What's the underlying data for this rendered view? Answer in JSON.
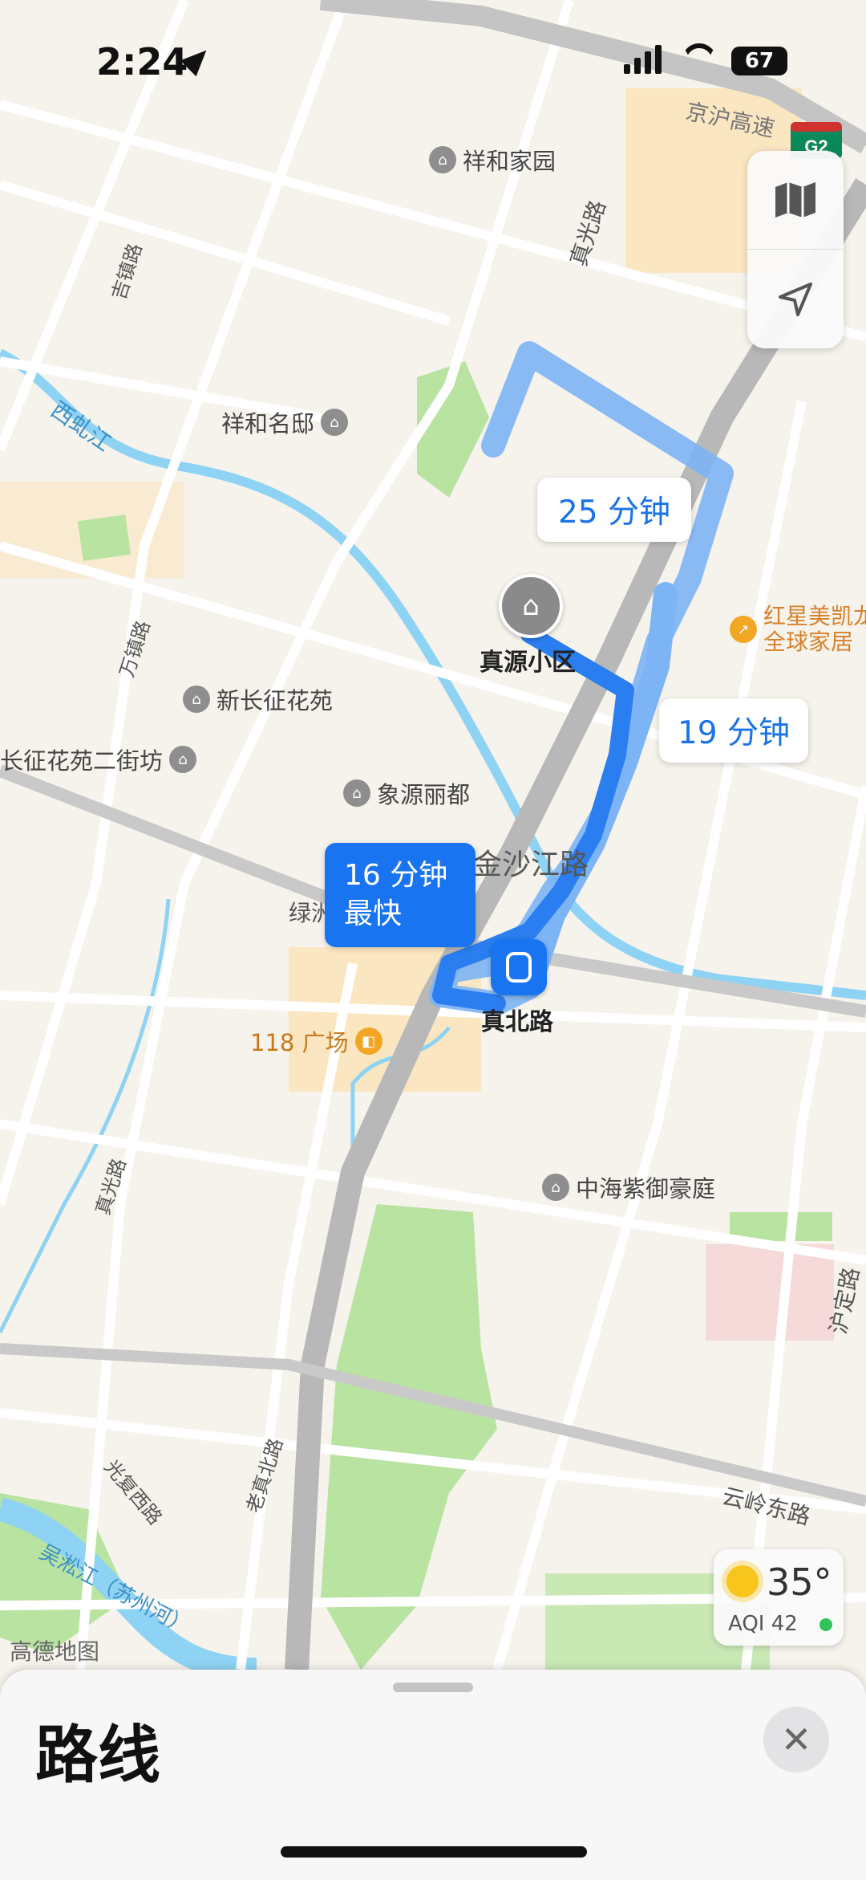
{
  "status_bar": {
    "time": "2:24",
    "battery": "67"
  },
  "map": {
    "labels": [
      {
        "name": "road-label-jinghu-highway",
        "text": "京沪高速"
      },
      {
        "name": "road-label-zhenguang-road-north",
        "text": "真光路"
      },
      {
        "name": "road-label-jizhen-road",
        "text": "吉镇路"
      },
      {
        "name": "river-label-xiyan-river",
        "text": "西虬江"
      },
      {
        "name": "road-label-wanzhen-road",
        "text": "万镇路"
      },
      {
        "name": "road-label-jinshajiang-road",
        "text": "金沙江路"
      },
      {
        "name": "road-label-lvzhou",
        "text": "绿洲"
      },
      {
        "name": "road-label-zhenguang-road-south",
        "text": "真光路"
      },
      {
        "name": "road-label-laozhenbei-road",
        "text": "老真北路"
      },
      {
        "name": "road-label-guangfu-west-road",
        "text": "光复西路"
      },
      {
        "name": "river-label-wusong-river",
        "text": "吴淞江（苏州河）"
      },
      {
        "name": "road-label-yunling-east-road",
        "text": "云岭东路"
      },
      {
        "name": "road-label-huding-road",
        "text": "沪定路"
      },
      {
        "name": "map-attribution",
        "text": "高德地图"
      }
    ],
    "pois": [
      {
        "name": "poi-xianghejiayuan",
        "text": "祥和家园"
      },
      {
        "name": "poi-xianghemingdi",
        "text": "祥和名邸"
      },
      {
        "name": "poi-xinchangzheng-huayuan",
        "text": "新长征花苑"
      },
      {
        "name": "poi-changzheng-huayuan-erjiefang",
        "text": "长征花苑二街坊"
      },
      {
        "name": "poi-xiangyuan-lidu",
        "text": "象源丽都"
      },
      {
        "name": "poi-118-plaza",
        "text": "118 广场"
      },
      {
        "name": "poi-zhonghai-ziyu-haoting",
        "text": "中海紫御豪庭"
      },
      {
        "name": "poi-hongxing-meikailong",
        "text": "红星美凯龙\n全球家居"
      }
    ],
    "destination": "真源小区",
    "station": "真北路",
    "highway_shield": "G2"
  },
  "routes": {
    "fastest": {
      "time": "16 分钟",
      "tag": "最快"
    },
    "alt1": "25 分钟",
    "alt2": "19 分钟"
  },
  "weather": {
    "temp": "35°",
    "aqi": "AQI 42"
  },
  "sheet": {
    "title": "路线"
  }
}
